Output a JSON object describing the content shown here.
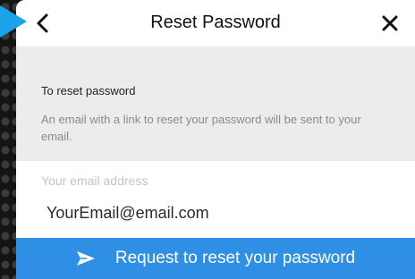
{
  "header": {
    "title": "Reset Password",
    "back_icon": "chevron-left-icon",
    "close_icon": "close-icon"
  },
  "info": {
    "heading": "To reset password",
    "text": "An email with a link to reset your password will be sent to your email."
  },
  "form": {
    "email_label": "Your email address",
    "email_value": "YourEmail@email.com"
  },
  "submit": {
    "label": "Request to reset your password",
    "icon": "send-icon"
  },
  "colors": {
    "accent": "#2f8fe5",
    "info_background": "#ececec",
    "pointer": "#1aa3e8"
  }
}
